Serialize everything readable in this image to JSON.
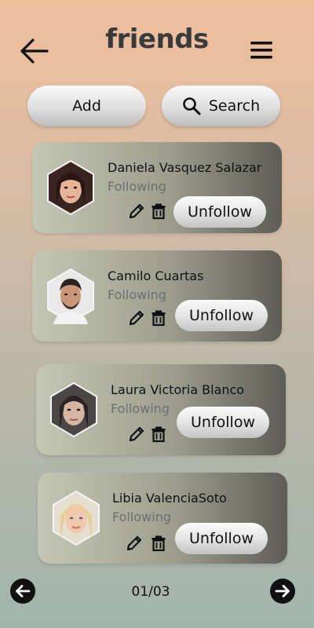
{
  "header": {
    "title": "friends",
    "back_icon": "arrow-left-icon",
    "menu_icon": "hamburger-menu-icon"
  },
  "actions": {
    "add_label": "Add",
    "search_label": "Search",
    "search_icon": "magnifier-icon"
  },
  "friends": [
    {
      "name": "Daniela Vasquez Salazar",
      "status": "Following",
      "button": "Unfollow"
    },
    {
      "name": "Camilo Cuartas",
      "status": "Following",
      "button": "Unfollow"
    },
    {
      "name": "Laura Victoria Blanco",
      "status": "Following",
      "button": "Unfollow"
    },
    {
      "name": "Libia ValenciaSoto",
      "status": "Following",
      "button": "Unfollow"
    }
  ],
  "pagination": {
    "current": "01/03",
    "prev_icon": "circle-arrow-left-icon",
    "next_icon": "circle-arrow-right-icon"
  },
  "colors": {
    "bg_top": "#efbf9c",
    "bg_bottom": "#a2b5ad",
    "card_dark": "#5d5d56",
    "card_light": "#c5c7b5"
  }
}
